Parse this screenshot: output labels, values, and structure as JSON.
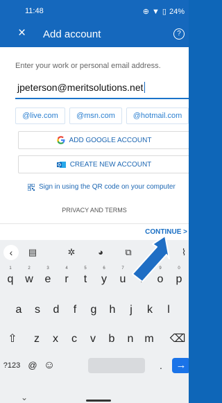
{
  "status_bar": {
    "time": "11:48",
    "battery": "24%"
  },
  "app_bar": {
    "close_icon": "×",
    "title": "Add account",
    "help_icon": "?"
  },
  "form": {
    "prompt": "Enter your work or personal email address.",
    "email_value": "jpeterson@meritsolutions.net"
  },
  "suggestions": [
    "@live.com",
    "@msn.com",
    "@hotmail.com"
  ],
  "buttons": {
    "google": "ADD GOOGLE ACCOUNT",
    "create": "CREATE NEW ACCOUNT",
    "qr": "Sign in using the QR code on your computer",
    "privacy": "PRIVACY AND TERMS",
    "continue": "CONTINUE >"
  },
  "keyboard": {
    "row1": [
      {
        "k": "q",
        "n": "1"
      },
      {
        "k": "w",
        "n": "2"
      },
      {
        "k": "e",
        "n": "3"
      },
      {
        "k": "r",
        "n": "4"
      },
      {
        "k": "t",
        "n": "5"
      },
      {
        "k": "y",
        "n": "6"
      },
      {
        "k": "u",
        "n": "7"
      },
      {
        "k": "i",
        "n": "8"
      },
      {
        "k": "o",
        "n": "9"
      },
      {
        "k": "p",
        "n": "0"
      }
    ],
    "row2": [
      "a",
      "s",
      "d",
      "f",
      "g",
      "h",
      "j",
      "k",
      "l"
    ],
    "row3": [
      "z",
      "x",
      "c",
      "v",
      "b",
      "n",
      "m"
    ],
    "symbols": "?123",
    "at": "@",
    "period": ".",
    "shift_icon": "⇧",
    "backspace_icon": "⌫",
    "enter_icon": "→",
    "hide_icon": "⌄"
  },
  "colors": {
    "brand": "#1568bd",
    "link": "#1d67b3",
    "enter_key": "#1a73e8",
    "arrow": "#1f6ec4"
  }
}
